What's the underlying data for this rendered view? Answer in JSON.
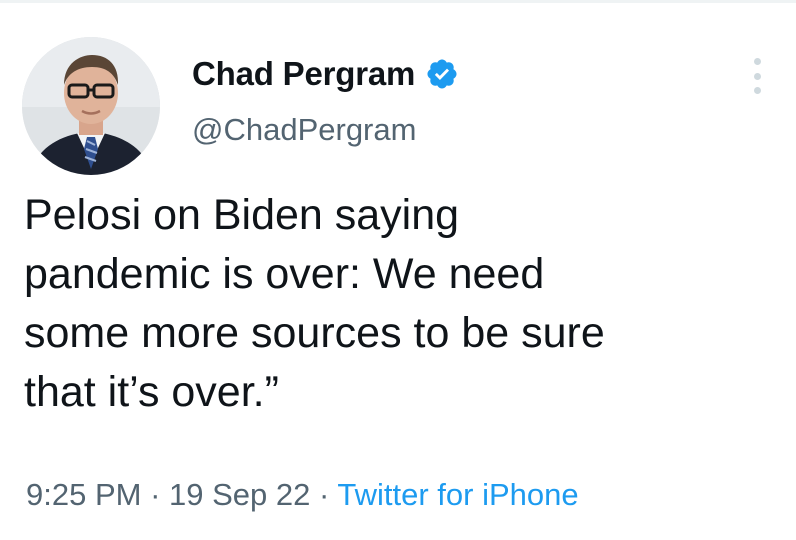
{
  "author": {
    "display_name": "Chad Pergram",
    "handle": "@ChadPergram",
    "verified": true,
    "avatar": "headshot-photo"
  },
  "tweet": {
    "text": "Pelosi on Biden saying\npandemic is over: We need\nsome more sources to be sure\nthat it’s over.”"
  },
  "meta": {
    "time": "9:25 PM",
    "separator": " · ",
    "date": "19 Sep 22",
    "source": "Twitter for iPhone"
  },
  "icons": {
    "verified": "verified-badge-icon",
    "more": "more-options-icon"
  },
  "colors": {
    "text": "#0f1419",
    "secondary": "#536471",
    "link": "#1d9bf0",
    "verified": "#1d9bf0"
  }
}
